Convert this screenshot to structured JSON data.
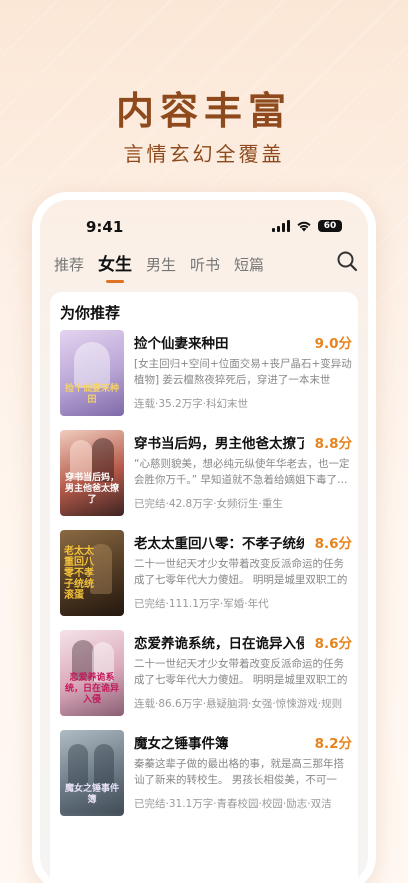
{
  "hero": {
    "title": "内容丰富",
    "subtitle": "言情玄幻全覆盖"
  },
  "status_bar": {
    "time": "9:41",
    "battery": "60"
  },
  "tabs": [
    {
      "label": "推荐",
      "active": false
    },
    {
      "label": "女生",
      "active": true
    },
    {
      "label": "男生",
      "active": false
    },
    {
      "label": "听书",
      "active": false
    },
    {
      "label": "短篇",
      "active": false
    }
  ],
  "section": {
    "title": "为你推荐"
  },
  "books": [
    {
      "title": "捡个仙妻来种田",
      "score": "9.0分",
      "desc": "[女主回归+空间+位面交易+丧尸晶石+变异动植物] 姜云檀熬夜猝死后，穿进了一本末世文。…",
      "meta": "连载·35.2万字·科幻末世",
      "cover_text": "捡个仙妻来种田",
      "cover_colors": [
        "#d9c7e6",
        "#b9a4d6",
        "#8e7bb8"
      ]
    },
    {
      "title": "穿书当后妈，男主他爸太撩了",
      "score": "8.8分",
      "desc": "“心慈则貌美，想必纯元纵使年华老去，也一定会胜你万千。” 早知道就不急着给嫡姐下毒了…",
      "meta": "已完结·42.8万字·女频衍生·重生",
      "cover_text": "穿书当后妈，男主他爸太撩了",
      "cover_colors": [
        "#e8b7a4",
        "#b55a4a",
        "#4a2c2a"
      ]
    },
    {
      "title": "老太太重回八零：不孝子统统滚蛋",
      "score": "8.6分",
      "desc": "二十一世纪天才少女带着改变反派命运的任务成了七零年代大力傻妞。 明明是城里双职工的孩…",
      "meta": "已完结·111.1万字·军婚·年代",
      "cover_text": "老太太重回八零不孝子统统滚蛋",
      "cover_colors": [
        "#7a5a36",
        "#4a3520",
        "#2a1d12"
      ]
    },
    {
      "title": "恋爱养诡系统，日在诡异入侵",
      "score": "8.6分",
      "desc": "二十一世纪天才少女带着改变反派命运的任务成了七零年代大力傻妞。 明明是城里双职工的孩…",
      "meta": "连载·86.6万字·悬疑脑洞·女强·惊悚游戏·规则",
      "cover_text": "恋爱养诡系统，日在诡异入侵",
      "cover_colors": [
        "#f1d6df",
        "#d9a9ba",
        "#8b5e74"
      ]
    },
    {
      "title": "魔女之锤事件簿",
      "score": "8.2分",
      "desc": "秦蓁这辈子做的最出格的事，就是高三那年搭讪了新来的转校生。 男孩长相俊美，不可一世。…",
      "meta": "已完结·31.1万字·青春校园·校园·励志·双洁",
      "cover_text": "魔女之锤事件簿",
      "cover_colors": [
        "#9aa7b0",
        "#6b7a86",
        "#3f4a54"
      ]
    }
  ]
}
